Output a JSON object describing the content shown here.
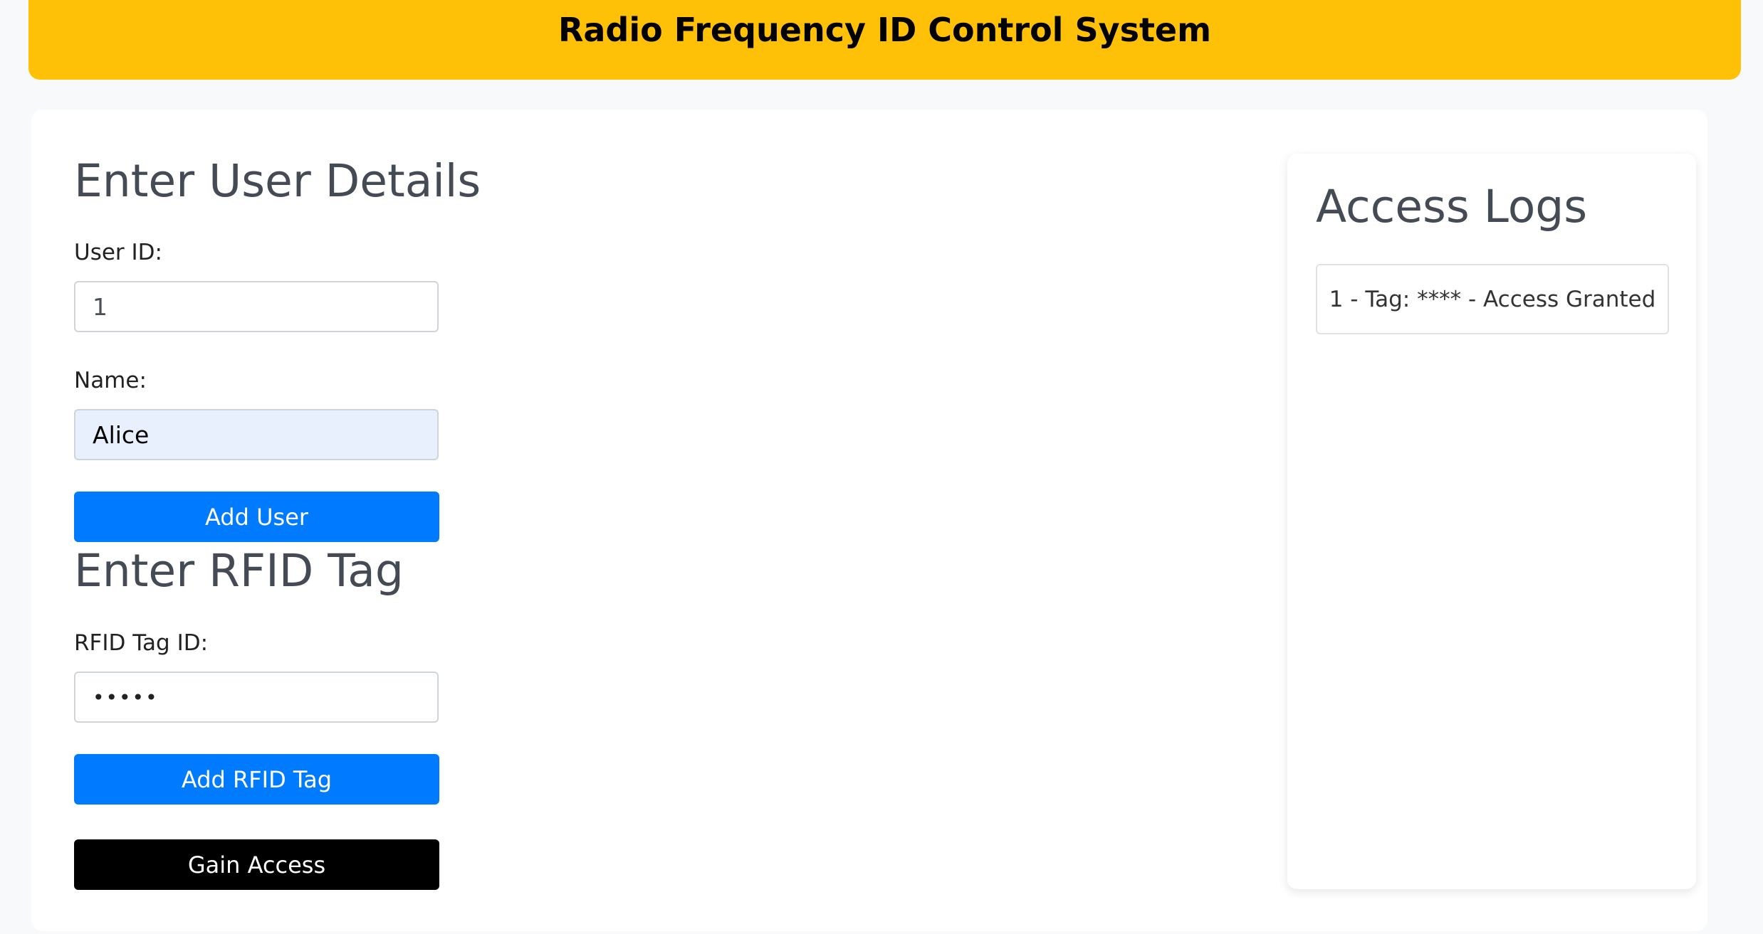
{
  "header": {
    "title": "Radio Frequency ID Control System"
  },
  "user_form": {
    "heading": "Enter User Details",
    "user_id_label": "User ID:",
    "user_id_value": "1",
    "name_label": "Name:",
    "name_value": "Alice",
    "add_user_label": "Add User"
  },
  "rfid_form": {
    "heading": "Enter RFID Tag",
    "tag_label": "RFID Tag ID:",
    "tag_value_masked": "•••••",
    "add_tag_label": "Add RFID Tag",
    "gain_access_label": "Gain Access"
  },
  "access_logs": {
    "heading": "Access Logs",
    "entries": [
      "1 - Tag: **** - Access Granted"
    ]
  },
  "colors": {
    "header_bg": "#ffc107",
    "primary_button": "#007bff",
    "access_button": "#000000",
    "autofill_bg": "#e8f0fe"
  }
}
